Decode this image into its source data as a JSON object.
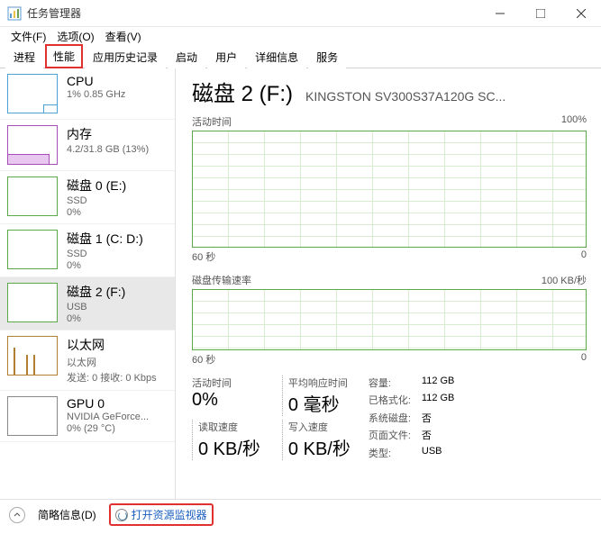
{
  "window": {
    "title": "任务管理器"
  },
  "menu": {
    "file": "文件(F)",
    "options": "选项(O)",
    "view": "查看(V)"
  },
  "tabs": {
    "process": "进程",
    "performance": "性能",
    "apphistory": "应用历史记录",
    "startup": "启动",
    "users": "用户",
    "details": "详细信息",
    "services": "服务"
  },
  "sidebar": {
    "cpu": {
      "title": "CPU",
      "sub": "1%  0.85 GHz"
    },
    "mem": {
      "title": "内存",
      "sub": "4.2/31.8 GB (13%)"
    },
    "disk0": {
      "title": "磁盘 0 (E:)",
      "sub1": "SSD",
      "sub2": "0%"
    },
    "disk1": {
      "title": "磁盘 1 (C: D:)",
      "sub1": "SSD",
      "sub2": "0%"
    },
    "disk2": {
      "title": "磁盘 2 (F:)",
      "sub1": "USB",
      "sub2": "0%"
    },
    "eth": {
      "title": "以太网",
      "sub1": "以太网",
      "sub2": "发送: 0  接收: 0 Kbps"
    },
    "gpu": {
      "title": "GPU 0",
      "sub1": "NVIDIA GeForce...",
      "sub2": "0% (29 °C)"
    }
  },
  "detail": {
    "title": "磁盘 2 (F:)",
    "model": "KINGSTON  SV300S37A120G SC...",
    "chart1": {
      "label": "活动时间",
      "max": "100%",
      "xleft": "60 秒",
      "xright": "0"
    },
    "chart2": {
      "label": "磁盘传输速率",
      "max": "100 KB/秒",
      "xleft": "60 秒",
      "xright": "0"
    },
    "stats": {
      "active_label": "活动时间",
      "active_value": "0%",
      "resp_label": "平均响应时间",
      "resp_value": "0 毫秒",
      "read_label": "读取速度",
      "read_value": "0 KB/秒",
      "write_label": "写入速度",
      "write_value": "0 KB/秒"
    },
    "info": {
      "capacity_l": "容量:",
      "capacity_v": "112 GB",
      "formatted_l": "已格式化:",
      "formatted_v": "112 GB",
      "sysdisk_l": "系统磁盘:",
      "sysdisk_v": "否",
      "pagefile_l": "页面文件:",
      "pagefile_v": "否",
      "type_l": "类型:",
      "type_v": "USB"
    }
  },
  "footer": {
    "brief": "简略信息(D)",
    "resmon": "打开资源监视器"
  },
  "chart_data": [
    {
      "type": "line",
      "title": "活动时间",
      "ylabel": "%",
      "ylim": [
        0,
        100
      ],
      "x_range_seconds": 60,
      "values": []
    },
    {
      "type": "line",
      "title": "磁盘传输速率",
      "ylabel": "KB/秒",
      "ylim": [
        0,
        100
      ],
      "x_range_seconds": 60,
      "values": []
    }
  ]
}
